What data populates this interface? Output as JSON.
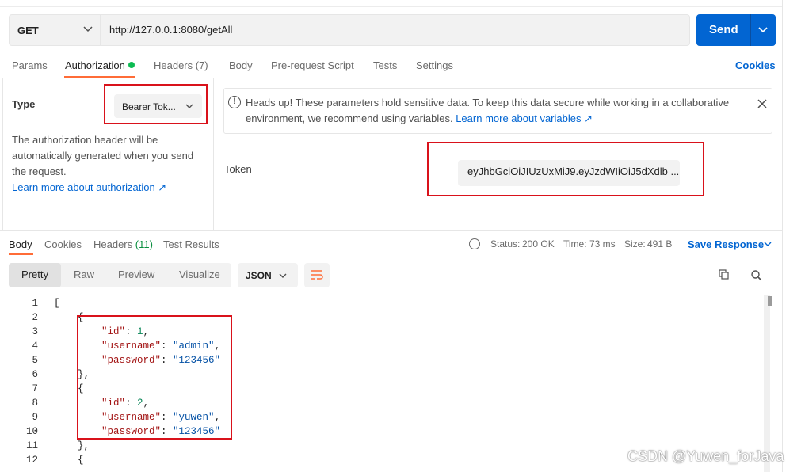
{
  "request": {
    "method": "GET",
    "url": "http://127.0.0.1:8080/getAll",
    "send_label": "Send"
  },
  "tabs": [
    {
      "label": "Params"
    },
    {
      "label": "Authorization"
    },
    {
      "label": "Headers (7)"
    },
    {
      "label": "Body"
    },
    {
      "label": "Pre-request Script"
    },
    {
      "label": "Tests"
    },
    {
      "label": "Settings"
    }
  ],
  "cookies_label": "Cookies",
  "auth": {
    "type_label": "Type",
    "type_value": "Bearer Tok...",
    "desc": "The authorization header will be automatically generated when you send the request.",
    "learn_more": "Learn more about authorization ↗",
    "alert_text": "Heads up! These parameters hold sensitive data. To keep this data secure while working in a collaborative environment, we recommend using variables.",
    "alert_link": "Learn more about variables ↗",
    "token_label": "Token",
    "token_value": "eyJhbGciOiJIUzUxMiJ9.eyJzdWIiOiJ5dXdlb ..."
  },
  "response": {
    "tabs": [
      {
        "label": "Body"
      },
      {
        "label": "Cookies"
      },
      {
        "label": "Headers"
      },
      {
        "label": "Test Results"
      }
    ],
    "headers_count": "(11)",
    "status_label": "Status:",
    "status_value": "200 OK",
    "time_label": "Time:",
    "time_value": "73 ms",
    "size_label": "Size:",
    "size_value": "491 B",
    "save_label": "Save Response",
    "views": [
      "Pretty",
      "Raw",
      "Preview",
      "Visualize"
    ],
    "format": "JSON"
  },
  "code_lines": [
    {
      "num": "1"
    },
    {
      "num": "2"
    },
    {
      "num": "3"
    },
    {
      "num": "4"
    },
    {
      "num": "5"
    },
    {
      "num": "6"
    },
    {
      "num": "7"
    },
    {
      "num": "8"
    },
    {
      "num": "9"
    },
    {
      "num": "10"
    },
    {
      "num": "11"
    },
    {
      "num": "12"
    }
  ],
  "records": [
    {
      "id": "1",
      "username": "\"admin\"",
      "password": "\"123456\""
    },
    {
      "id": "2",
      "username": "\"yuwen\"",
      "password": "\"123456\""
    }
  ],
  "keys": {
    "id": "\"id\"",
    "username": "\"username\"",
    "password": "\"password\""
  },
  "watermark": "CSDN @Yuwen_forJava"
}
